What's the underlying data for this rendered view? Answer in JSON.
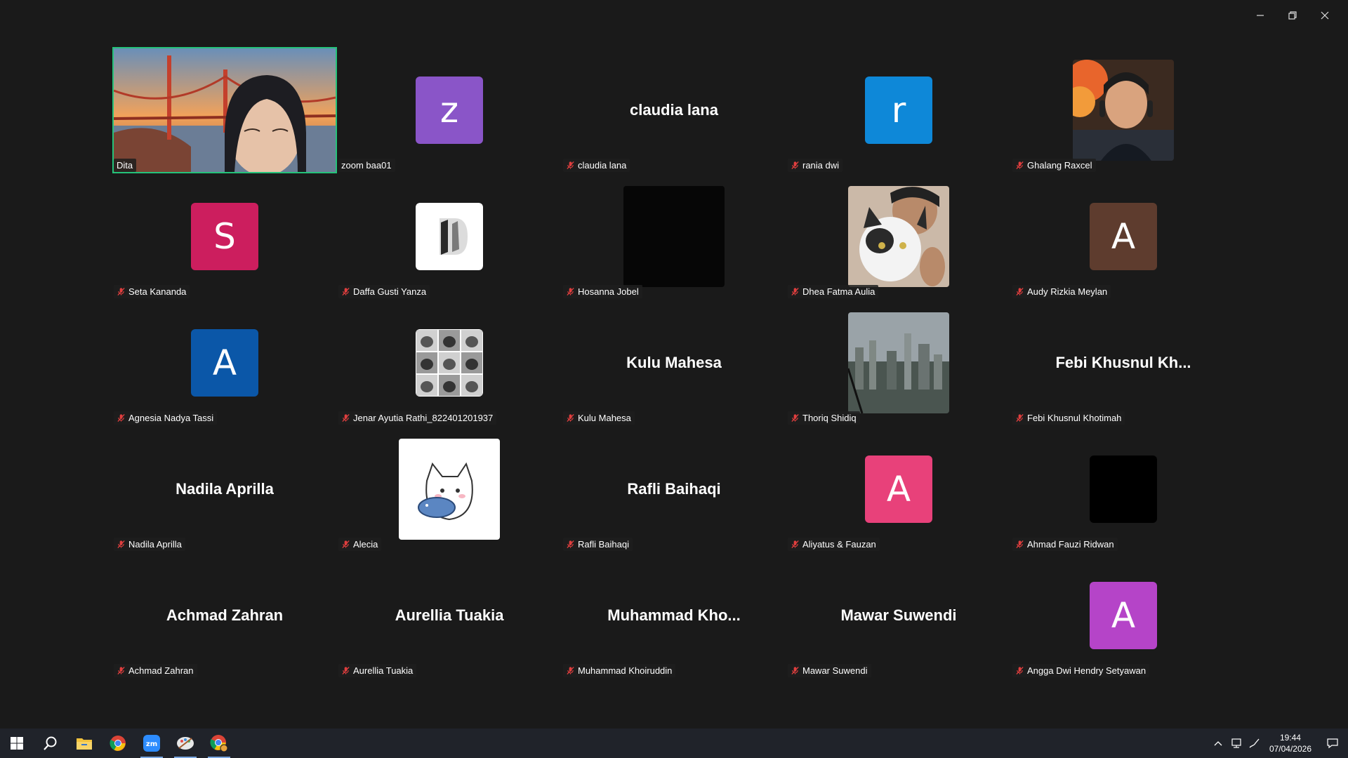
{
  "window": {
    "controls": [
      "minimize",
      "restore",
      "close"
    ]
  },
  "participants": [
    {
      "name": "Dita",
      "type": "video",
      "active": true
    },
    {
      "name": "zoom baa01",
      "type": "avatar",
      "letter": "z",
      "color": "#8a55c8",
      "muted": false
    },
    {
      "name": "claudia lana",
      "type": "text",
      "big": "claudia lana",
      "muted": true
    },
    {
      "name": "rania dwi",
      "type": "avatar",
      "letter": "r",
      "color": "#0e88d8",
      "muted": true
    },
    {
      "name": "Ghalang Raxcel",
      "type": "photo",
      "photo": "person-fire",
      "muted": true
    },
    {
      "name": "Seta Kananda",
      "type": "avatar",
      "letter": "S",
      "color": "#cc1e5e",
      "muted": true
    },
    {
      "name": "Daffa Gusti Yanza",
      "type": "photo-small",
      "photo": "logo-white",
      "muted": true
    },
    {
      "name": "Hosanna Jobel",
      "type": "photo",
      "photo": "black",
      "muted": true
    },
    {
      "name": "Dhea Fatma Aulia",
      "type": "photo",
      "photo": "cat-person",
      "muted": true
    },
    {
      "name": "Audy Rizkia Meylan",
      "type": "avatar",
      "letter": "A",
      "color": "#5e3c2e",
      "muted": true
    },
    {
      "name": "Agnesia Nadya Tassi",
      "type": "avatar",
      "letter": "A",
      "color": "#0b57a8",
      "muted": true
    },
    {
      "name": "Jenar Ayutia Rathi_822401201937",
      "type": "photo-small",
      "photo": "cats-grid",
      "muted": true
    },
    {
      "name": "Kulu Mahesa",
      "type": "text",
      "big": "Kulu Mahesa",
      "muted": true
    },
    {
      "name": "Thoriq Shidiq",
      "type": "photo",
      "photo": "city",
      "muted": true
    },
    {
      "name": "Febi Khusnul Khotimah",
      "type": "text",
      "big": "Febi  Khusnul  Kh...",
      "muted": true
    },
    {
      "name": "Nadila Aprilla",
      "type": "text",
      "big": "Nadila Aprilla",
      "muted": true
    },
    {
      "name": "Alecia",
      "type": "photo",
      "photo": "cat-cartoon",
      "muted": true
    },
    {
      "name": "Rafli Baihaqi",
      "type": "text",
      "big": "Rafli Baihaqi",
      "muted": true
    },
    {
      "name": "Aliyatus & Fauzan",
      "type": "avatar",
      "letter": "A",
      "color": "#e8417a",
      "muted": true
    },
    {
      "name": "Ahmad Fauzi Ridwan",
      "type": "avatar",
      "letter": "",
      "color": "#000000",
      "muted": true
    },
    {
      "name": "Achmad Zahran",
      "type": "text",
      "big": "Achmad Zahran",
      "muted": true
    },
    {
      "name": "Aurellia Tuakia",
      "type": "text",
      "big": "Aurellia Tuakia",
      "muted": true
    },
    {
      "name": "Muhammad Khoiruddin",
      "type": "text",
      "big": "Muhammad  Kho...",
      "muted": true
    },
    {
      "name": "Mawar Suwendi",
      "type": "text",
      "big": "Mawar Suwendi",
      "muted": true
    },
    {
      "name": "Angga Dwi Hendry Setyawan",
      "type": "avatar",
      "letter": "A",
      "color": "#b544c8",
      "muted": true
    }
  ],
  "taskbar": {
    "apps": [
      "start-icon",
      "search-icon",
      "file-explorer-icon",
      "chrome-icon",
      "zoom-icon",
      "paint-icon",
      "chrome-profile-icon"
    ],
    "time": "19:44",
    "date": "07/04/2026"
  }
}
